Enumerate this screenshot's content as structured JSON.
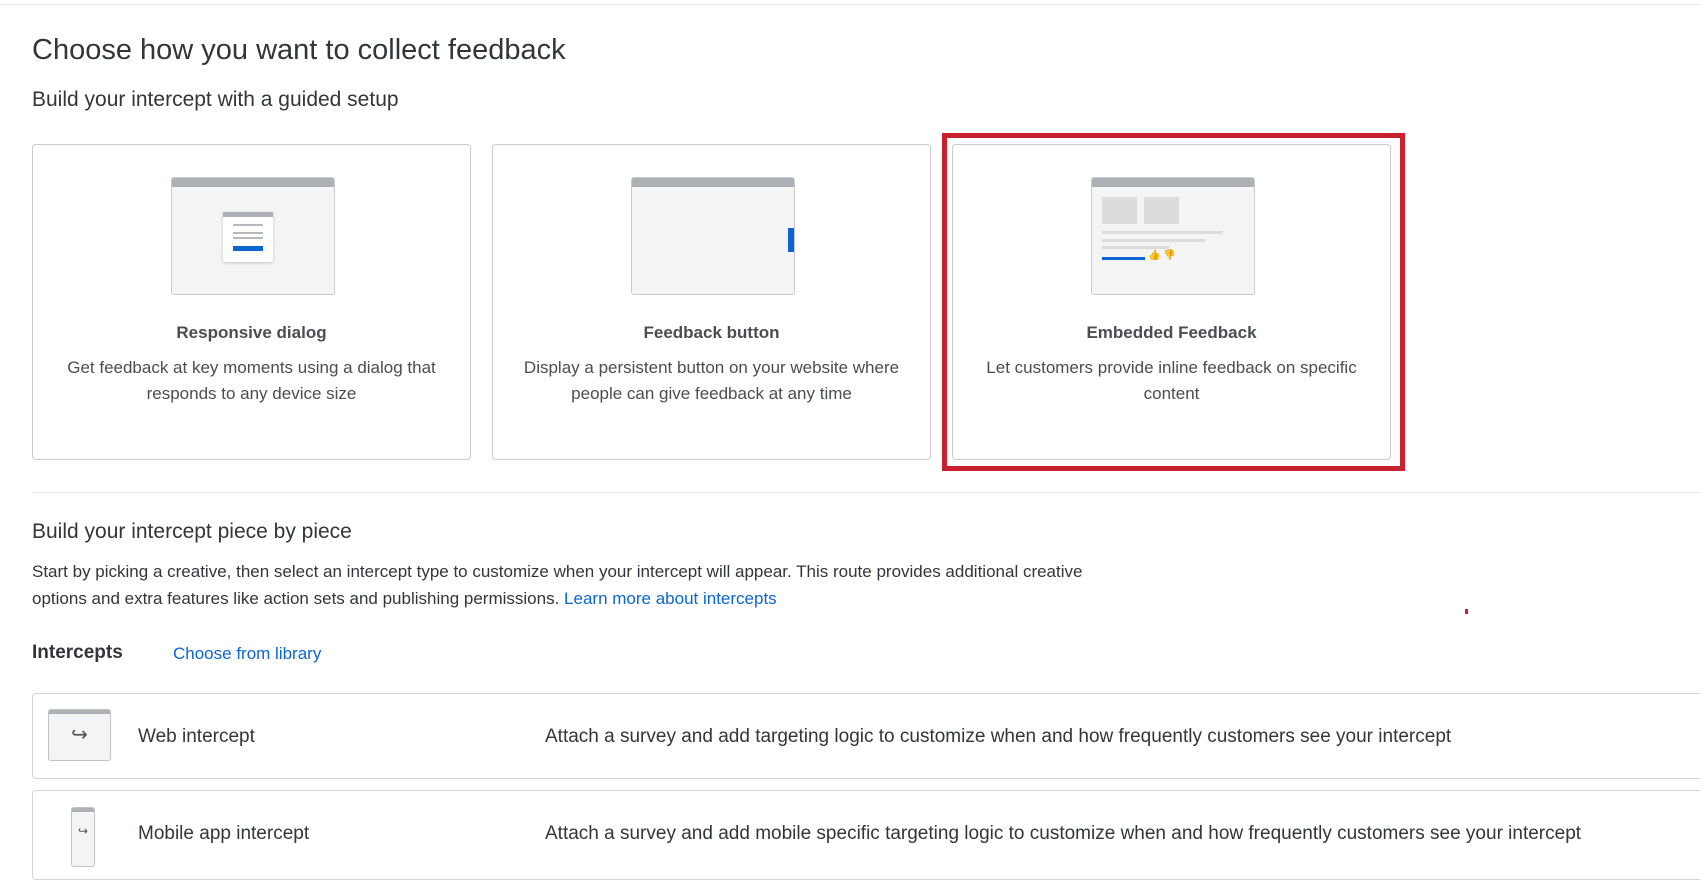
{
  "page": {
    "title": "Choose how you want to collect feedback",
    "guided_subtitle": "Build your intercept with a guided setup"
  },
  "cards": [
    {
      "name": "Responsive dialog",
      "desc": "Get feedback at key moments using a dialog that responds to any device size"
    },
    {
      "name": "Feedback button",
      "desc": "Display a persistent button on your website where people can give feedback at any time"
    },
    {
      "name": "Embedded Feedback",
      "desc": "Let customers provide inline feedback on specific content"
    }
  ],
  "piece": {
    "title": "Build your intercept piece by piece",
    "text": "Start by picking a creative, then select an intercept type to customize when your intercept will appear. This route provides additional creative options and extra features like action sets and publishing permissions.",
    "link": "Learn more about intercepts"
  },
  "intercepts": {
    "label": "Intercepts",
    "library": "Choose from library",
    "rows": [
      {
        "name": "Web intercept",
        "desc": "Attach a survey and add targeting logic to customize when and how frequently customers see your intercept"
      },
      {
        "name": "Mobile app intercept",
        "desc": "Attach a survey and add mobile specific targeting logic to customize when and how frequently customers see your intercept"
      }
    ]
  },
  "colors": {
    "accent": "#0b66d1",
    "highlight": "#c8202f"
  }
}
